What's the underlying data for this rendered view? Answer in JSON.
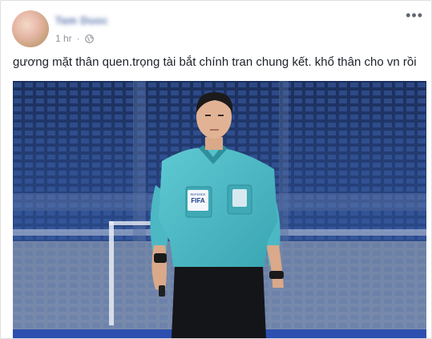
{
  "post": {
    "author_name": "Tam Duoc",
    "time": "1 hr",
    "time_separator": "·",
    "privacy_icon": "globe-icon",
    "more_icon": "more-options-icon",
    "more_glyph": "•••",
    "text": "gương mặt thân quen.trọng tài bắt chính tran chung kết. khổ thân cho vn rồi",
    "photo": {
      "badge_text": "FIFA",
      "badge_sub": "REFEREE"
    }
  },
  "colors": {
    "link_blue": "#365899",
    "meta_gray": "#90949c",
    "shirt_teal": "#4bb8c4",
    "stadium_blue": "#2b4a8a"
  }
}
